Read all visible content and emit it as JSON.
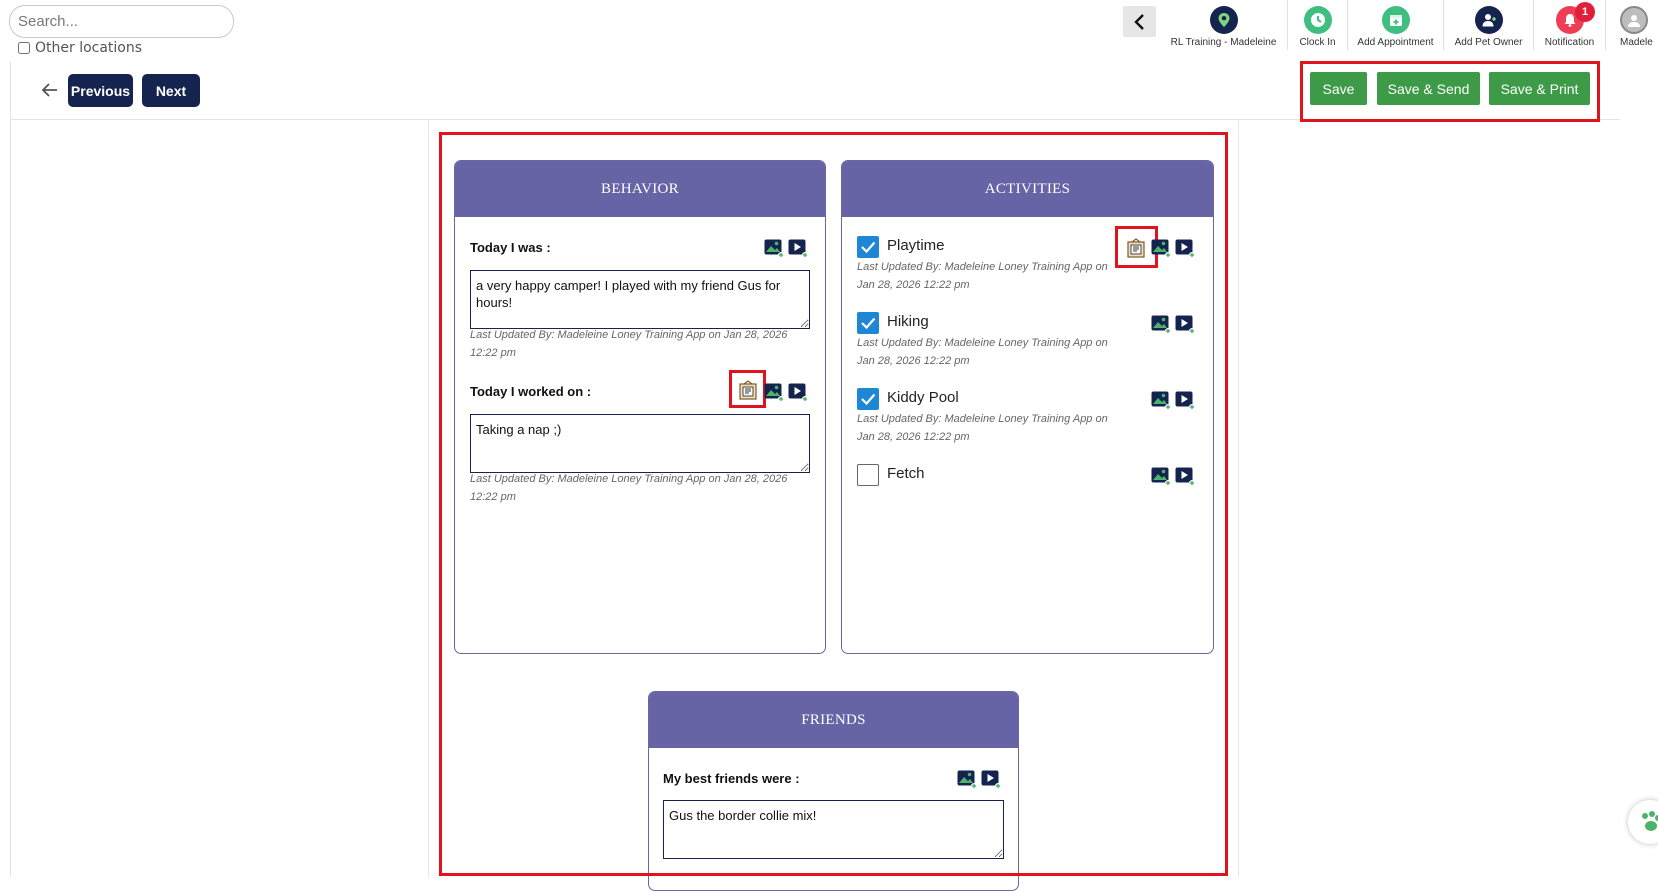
{
  "search": {
    "placeholder": "Search..."
  },
  "other_locations": {
    "label": "Other locations",
    "checked": false
  },
  "topnav": {
    "items": [
      {
        "label": "RL Training - Madeleine",
        "icon": "location-pin-icon"
      },
      {
        "label": "Clock In",
        "icon": "clock-icon"
      },
      {
        "label": "Add Appointment",
        "icon": "calendar-add-icon"
      },
      {
        "label": "Add Pet Owner",
        "icon": "add-person-icon"
      },
      {
        "label": "Notification",
        "icon": "bell-icon",
        "badge": "1"
      },
      {
        "label": "Madele",
        "icon": "avatar-icon"
      }
    ]
  },
  "toolbar": {
    "previous_label": "Previous",
    "next_label": "Next",
    "save_label": "Save",
    "save_send_label": "Save & Send",
    "save_print_label": "Save & Print"
  },
  "behavior": {
    "title": "BEHAVIOR",
    "fields": [
      {
        "label": "Today I was :",
        "value": "a very happy camper! I played with my friend Gus for hours!",
        "updated": "Last Updated By: Madeleine Loney Training App on Jan 28, 2026 12:22 pm"
      },
      {
        "label": "Today I worked on :",
        "value": "Taking a nap ;)",
        "updated": "Last Updated By: Madeleine Loney Training App on Jan 28, 2026 12:22 pm"
      }
    ]
  },
  "activities": {
    "title": "ACTIVITIES",
    "items": [
      {
        "label": "Playtime",
        "checked": true,
        "updated_line1": "Last Updated By: Madeleine Loney Training App on",
        "updated_line2": "Jan 28, 2026 12:22 pm"
      },
      {
        "label": "Hiking",
        "checked": true,
        "updated_line1": "Last Updated By: Madeleine Loney Training App on",
        "updated_line2": "Jan 28, 2026 12:22 pm"
      },
      {
        "label": "Kiddy Pool",
        "checked": true,
        "updated_line1": "Last Updated By: Madeleine Loney Training App on",
        "updated_line2": "Jan 28, 2026 12:22 pm"
      },
      {
        "label": "Fetch",
        "checked": false,
        "updated_line1": "",
        "updated_line2": ""
      }
    ]
  },
  "friends": {
    "title": "FRIENDS",
    "label": "My best friends were :",
    "value": "Gus the border collie mix!"
  },
  "colors": {
    "navy": "#14244f",
    "green": "#3d9a46",
    "purple": "#6764a6",
    "highlight_red": "#e0141d",
    "checkbox_blue": "#1d87d6"
  }
}
